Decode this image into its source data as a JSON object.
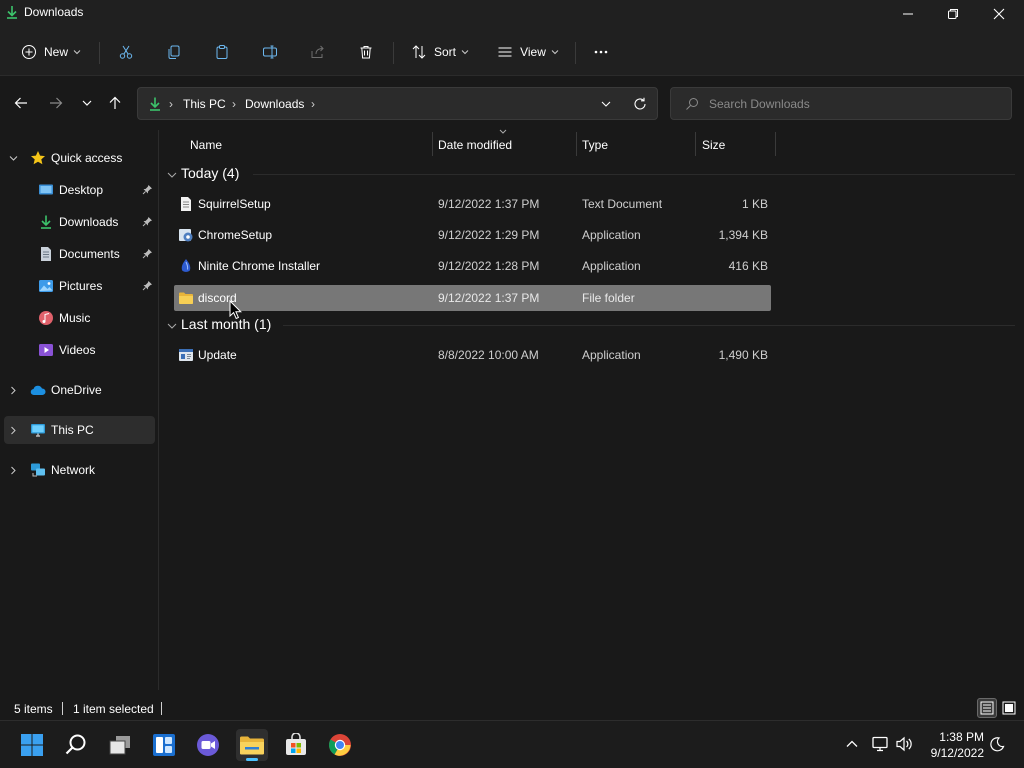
{
  "window": {
    "title": "Downloads"
  },
  "toolbar": {
    "new_label": "New",
    "sort_label": "Sort",
    "view_label": "View",
    "more_label": "···"
  },
  "address": {
    "crumbs": [
      "This PC",
      "Downloads"
    ],
    "search_placeholder": "Search Downloads"
  },
  "sidebar": {
    "quick_access": "Quick access",
    "items": [
      {
        "label": "Desktop",
        "icon": "desktop-icon",
        "pinned": true
      },
      {
        "label": "Downloads",
        "icon": "downloads-icon",
        "pinned": true
      },
      {
        "label": "Documents",
        "icon": "documents-icon",
        "pinned": true
      },
      {
        "label": "Pictures",
        "icon": "pictures-icon",
        "pinned": true
      },
      {
        "label": "Music",
        "icon": "music-icon",
        "pinned": false
      },
      {
        "label": "Videos",
        "icon": "videos-icon",
        "pinned": false
      }
    ],
    "onedrive": "OneDrive",
    "this_pc": "This PC",
    "network": "Network"
  },
  "columns": {
    "name": "Name",
    "date": "Date modified",
    "type": "Type",
    "size": "Size"
  },
  "groups": [
    {
      "label": "Today (4)",
      "files": [
        {
          "name": "SquirrelSetup",
          "date": "9/12/2022 1:37 PM",
          "type": "Text Document",
          "size": "1 KB",
          "icon": "text-file-icon"
        },
        {
          "name": "ChromeSetup",
          "date": "9/12/2022 1:29 PM",
          "type": "Application",
          "size": "1,394 KB",
          "icon": "installer-icon"
        },
        {
          "name": "Ninite Chrome Installer",
          "date": "9/12/2022 1:28 PM",
          "type": "Application",
          "size": "416 KB",
          "icon": "ninite-icon"
        },
        {
          "name": "discord",
          "date": "9/12/2022 1:37 PM",
          "type": "File folder",
          "size": "",
          "icon": "folder-icon",
          "selected": true
        }
      ]
    },
    {
      "label": "Last month (1)",
      "files": [
        {
          "name": "Update",
          "date": "8/8/2022 10:00 AM",
          "type": "Application",
          "size": "1,490 KB",
          "icon": "app-window-icon"
        }
      ]
    }
  ],
  "status": {
    "items": "5 items",
    "selected": "1 item selected"
  },
  "clock": {
    "time": "1:38 PM",
    "date": "9/12/2022"
  },
  "colors": {
    "accent": "#4cc2ff",
    "selection": "#777777",
    "background": "#191919"
  }
}
